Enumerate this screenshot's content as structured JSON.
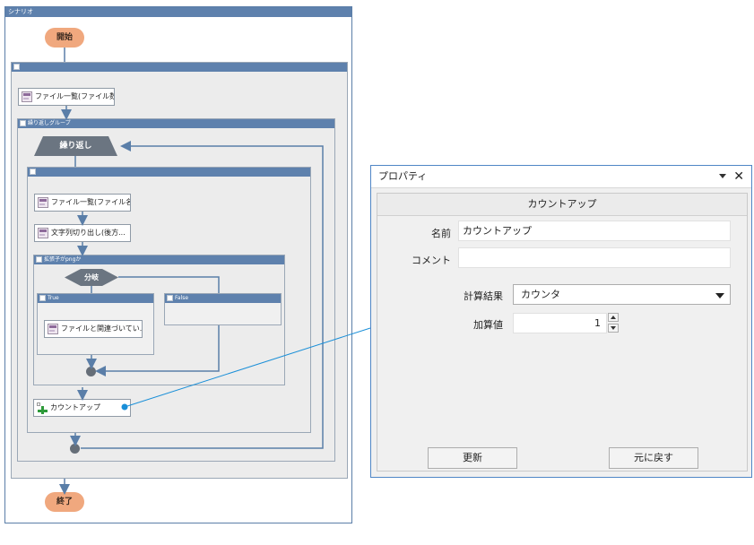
{
  "scenario": {
    "title": "シナリオ",
    "start_label": "開始",
    "end_label": "終了",
    "outer_group_title": "",
    "file_list_action": "ファイル一覧(ファイル数...",
    "loop_group_title": "繰り返しグループ",
    "loop_label": "繰り返し",
    "inner_group_title": "",
    "file_list_name_action": "ファイル一覧(ファイル名...",
    "string_cut_action": "文字列切り出し(後方...",
    "condition_group_title": "拡張子がpngか",
    "branch_label": "分岐",
    "true_label": "True",
    "false_label": "False",
    "file_assoc_action": "ファイルと関連づいてい...",
    "count_up_action": "カウントアップ"
  },
  "properties": {
    "title": "プロパティ",
    "header": "カウントアップ",
    "name_label": "名前",
    "name_value": "カウントアップ",
    "comment_label": "コメント",
    "comment_value": "",
    "result_label": "計算結果",
    "result_value": "カウンタ",
    "add_label": "加算値",
    "add_value": "1",
    "update_button": "更新",
    "revert_button": "元に戻す"
  },
  "colors": {
    "titlebar": "#5e81ad",
    "start_end": "#f0a87e",
    "connector": "#1a8fd8",
    "panel_border": "#4f86c6"
  }
}
